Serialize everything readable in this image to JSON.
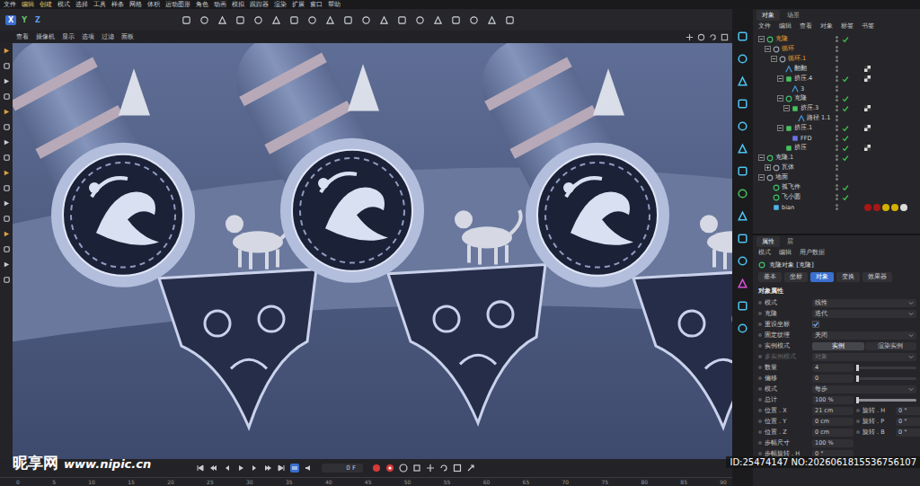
{
  "menu": [
    "文件",
    "编辑",
    "创建",
    "模式",
    "选择",
    "工具",
    "样条",
    "网格",
    "体积",
    "运动图形",
    "角色",
    "动画",
    "模拟",
    "跟踪器",
    "渲染",
    "扩展",
    "窗口",
    "帮助"
  ],
  "axes": [
    {
      "label": "X",
      "selected": true
    },
    {
      "label": "Y",
      "selected": false
    },
    {
      "label": "Z",
      "selected": false
    }
  ],
  "viewport": {
    "menu": [
      "查看",
      "摄像机",
      "显示",
      "选项",
      "过滤",
      "面板"
    ]
  },
  "timeline": {
    "ticks": [
      "0",
      "5",
      "10",
      "15",
      "20",
      "25",
      "30",
      "35",
      "40",
      "45",
      "50",
      "55",
      "60",
      "65",
      "70",
      "75",
      "80",
      "85",
      "90"
    ],
    "frame": "0 F"
  },
  "object_manager": {
    "tabs": [
      {
        "label": "对象",
        "selected": true
      },
      {
        "label": "场景",
        "selected": false
      }
    ],
    "menu": [
      "文件",
      "编辑",
      "查看",
      "对象",
      "标签",
      "书签"
    ],
    "items": [
      {
        "name": "克隆",
        "depth": 0,
        "kind": "cloner",
        "has_children": true,
        "expanded": true,
        "enabled": true,
        "selected": true,
        "tag": false,
        "materials": []
      },
      {
        "name": "循环",
        "depth": 1,
        "kind": "null",
        "has_children": true,
        "expanded": true,
        "enabled": false,
        "selected": true,
        "tag": false,
        "materials": []
      },
      {
        "name": "循环.1",
        "depth": 2,
        "kind": "null",
        "has_children": true,
        "expanded": true,
        "enabled": false,
        "selected": true,
        "tag": false,
        "materials": []
      },
      {
        "name": "翻翻",
        "depth": 3,
        "kind": "spline",
        "has_children": false,
        "expanded": false,
        "enabled": false,
        "selected": false,
        "tag": true,
        "materials": []
      },
      {
        "name": "挤压.4",
        "depth": 3,
        "kind": "extrude",
        "has_children": true,
        "expanded": true,
        "enabled": true,
        "selected": false,
        "tag": true,
        "materials": []
      },
      {
        "name": "3",
        "depth": 4,
        "kind": "spline",
        "has_children": false,
        "expanded": false,
        "enabled": false,
        "selected": false,
        "tag": false,
        "materials": []
      },
      {
        "name": "克隆",
        "depth": 3,
        "kind": "cloner",
        "has_children": true,
        "expanded": true,
        "enabled": true,
        "selected": false,
        "tag": false,
        "materials": []
      },
      {
        "name": "挤压.3",
        "depth": 4,
        "kind": "extrude",
        "has_children": true,
        "expanded": true,
        "enabled": true,
        "selected": false,
        "tag": true,
        "materials": []
      },
      {
        "name": "路径 1.1",
        "depth": 5,
        "kind": "spline",
        "has_children": false,
        "expanded": false,
        "enabled": false,
        "selected": false,
        "tag": false,
        "materials": []
      },
      {
        "name": "挤压.1",
        "depth": 3,
        "kind": "extrude",
        "has_children": true,
        "expanded": true,
        "enabled": true,
        "selected": false,
        "tag": true,
        "materials": []
      },
      {
        "name": "FFD",
        "depth": 4,
        "kind": "deformer",
        "has_children": false,
        "expanded": false,
        "enabled": true,
        "selected": false,
        "tag": false,
        "materials": []
      },
      {
        "name": "挤压",
        "depth": 3,
        "kind": "extrude",
        "has_children": false,
        "expanded": false,
        "enabled": true,
        "selected": false,
        "tag": true,
        "materials": []
      },
      {
        "name": "克隆.1",
        "depth": 0,
        "kind": "cloner",
        "has_children": true,
        "expanded": true,
        "enabled": true,
        "selected": false,
        "tag": false,
        "materials": []
      },
      {
        "name": "瓦体",
        "depth": 1,
        "kind": "null",
        "has_children": true,
        "expanded": false,
        "enabled": false,
        "selected": false,
        "tag": false,
        "materials": []
      },
      {
        "name": "地面",
        "depth": 0,
        "kind": "null",
        "has_children": true,
        "expanded": true,
        "enabled": false,
        "selected": false,
        "tag": false,
        "materials": []
      },
      {
        "name": "孤飞件",
        "depth": 1,
        "kind": "cloner",
        "has_children": false,
        "expanded": false,
        "enabled": true,
        "selected": false,
        "tag": false,
        "materials": []
      },
      {
        "name": "飞小圆",
        "depth": 1,
        "kind": "cloner",
        "has_children": false,
        "expanded": false,
        "enabled": true,
        "selected": false,
        "tag": false,
        "materials": []
      },
      {
        "name": "bian",
        "depth": 1,
        "kind": "object",
        "has_children": false,
        "expanded": false,
        "enabled": false,
        "selected": false,
        "tag": false,
        "materials": [
          "#a81616",
          "#a81616",
          "#d4b000",
          "#d4b000",
          "#dcdcdc"
        ]
      }
    ]
  },
  "attributes": {
    "tabs": [
      {
        "label": "属性",
        "selected": true
      },
      {
        "label": "层",
        "selected": false
      }
    ],
    "menu": [
      "模式",
      "编辑",
      "用户数据"
    ],
    "title": "克隆对象 [克隆]",
    "subtabs": [
      {
        "label": "基本",
        "selected": false
      },
      {
        "label": "坐标",
        "selected": false
      },
      {
        "label": "对象",
        "selected": true
      },
      {
        "label": "变换",
        "selected": false
      },
      {
        "label": "效果器",
        "selected": false
      }
    ],
    "section": "对象属性",
    "rows": [
      {
        "kind": "select",
        "label": "模式",
        "value": "线性",
        "disabled": false
      },
      {
        "kind": "select",
        "label": "克隆",
        "value": "迭代",
        "disabled": false
      },
      {
        "kind": "check",
        "label": "重设坐标",
        "checked": true,
        "disabled": false
      },
      {
        "kind": "select",
        "label": "固定纹理",
        "value": "关闭",
        "disabled": false
      },
      {
        "kind": "buttons",
        "label": "实例模式",
        "options": [
          {
            "label": "实例",
            "selected": true
          },
          {
            "label": "渲染实例",
            "selected": false
          }
        ],
        "disabled": false
      },
      {
        "kind": "select",
        "label": "多实例模式",
        "value": "对象",
        "disabled": true
      },
      {
        "kind": "slider",
        "label": "数量",
        "value": "4",
        "level": 0.03,
        "disabled": false
      },
      {
        "kind": "slider",
        "label": "偏移",
        "value": "0",
        "level": 0,
        "disabled": false
      },
      {
        "kind": "select",
        "label": "模式",
        "value": "每步",
        "disabled": false
      },
      {
        "kind": "slider",
        "label": "总计",
        "value": "100 %",
        "level": 1,
        "disabled": false
      },
      {
        "kind": "pair",
        "label": "位置 . X",
        "value": "21 cm",
        "label2": "旋转 . H",
        "value2": "0 °",
        "disabled": false
      },
      {
        "kind": "pair",
        "label": "位置 . Y",
        "value": "0 cm",
        "label2": "旋转 . P",
        "value2": "0 °",
        "disabled": false
      },
      {
        "kind": "pair",
        "label": "位置 . Z",
        "value": "0 cm",
        "label2": "旋转 . B",
        "value2": "0 °",
        "disabled": false
      },
      {
        "kind": "field",
        "label": "步幅尺寸",
        "value": "100 %",
        "disabled": false
      },
      {
        "kind": "field",
        "label": "步幅旋转 . H",
        "value": "0 °",
        "disabled": false
      }
    ]
  },
  "watermark": {
    "logo": "昵享网",
    "url": "www.nipic.cn",
    "id": "ID:25474147 NO:2026061815536756107"
  }
}
